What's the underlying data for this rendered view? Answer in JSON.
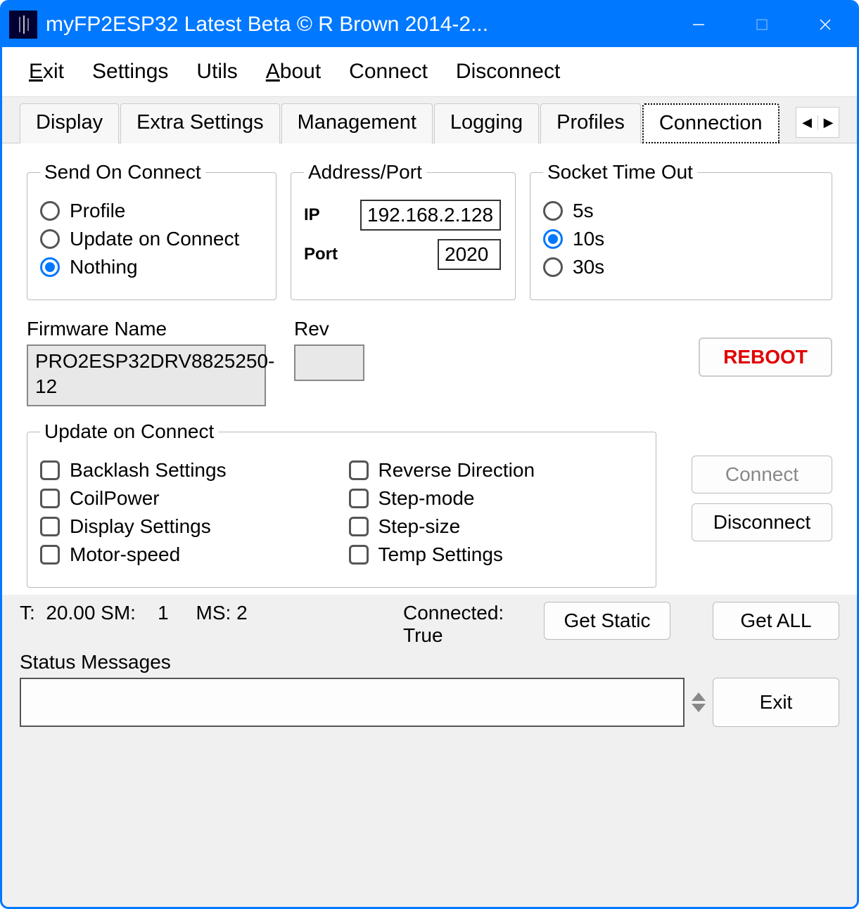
{
  "window": {
    "title": "myFP2ESP32 Latest Beta © R Brown 2014-2..."
  },
  "menu": {
    "items": [
      "Exit",
      "Settings",
      "Utils",
      "About",
      "Connect",
      "Disconnect"
    ]
  },
  "tabs": {
    "items": [
      "Display",
      "Extra Settings",
      "Management",
      "Logging",
      "Profiles",
      "Connection"
    ],
    "active": "Connection"
  },
  "send_on_connect": {
    "legend": "Send On Connect",
    "options": [
      "Profile",
      "Update on Connect",
      "Nothing"
    ],
    "selected": "Nothing"
  },
  "address_port": {
    "legend": "Address/Port",
    "ip_label": "IP",
    "ip_value": "192.168.2.128",
    "port_label": "Port",
    "port_value": "2020"
  },
  "socket_timeout": {
    "legend": "Socket Time Out",
    "options": [
      "5s",
      "10s",
      "30s"
    ],
    "selected": "10s"
  },
  "firmware": {
    "name_label": "Firmware Name",
    "name_value": "PRO2ESP32DRV8825250-12",
    "rev_label": "Rev",
    "rev_value": ""
  },
  "update_on_connect": {
    "legend": "Update on Connect",
    "left": [
      "Backlash Settings",
      "CoilPower",
      "Display Settings",
      "Motor-speed"
    ],
    "right": [
      "Reverse Direction",
      "Step-mode",
      "Step-size",
      "Temp Settings"
    ]
  },
  "buttons": {
    "reboot": "REBOOT",
    "connect": "Connect",
    "disconnect": "Disconnect",
    "get_static": "Get Static",
    "get_all": "Get ALL",
    "exit": "Exit"
  },
  "status": {
    "line": "T:  20.00 SM:    1     MS: 2",
    "connected_label": "Connected:",
    "connected_value": "True",
    "messages_label": "Status Messages"
  }
}
